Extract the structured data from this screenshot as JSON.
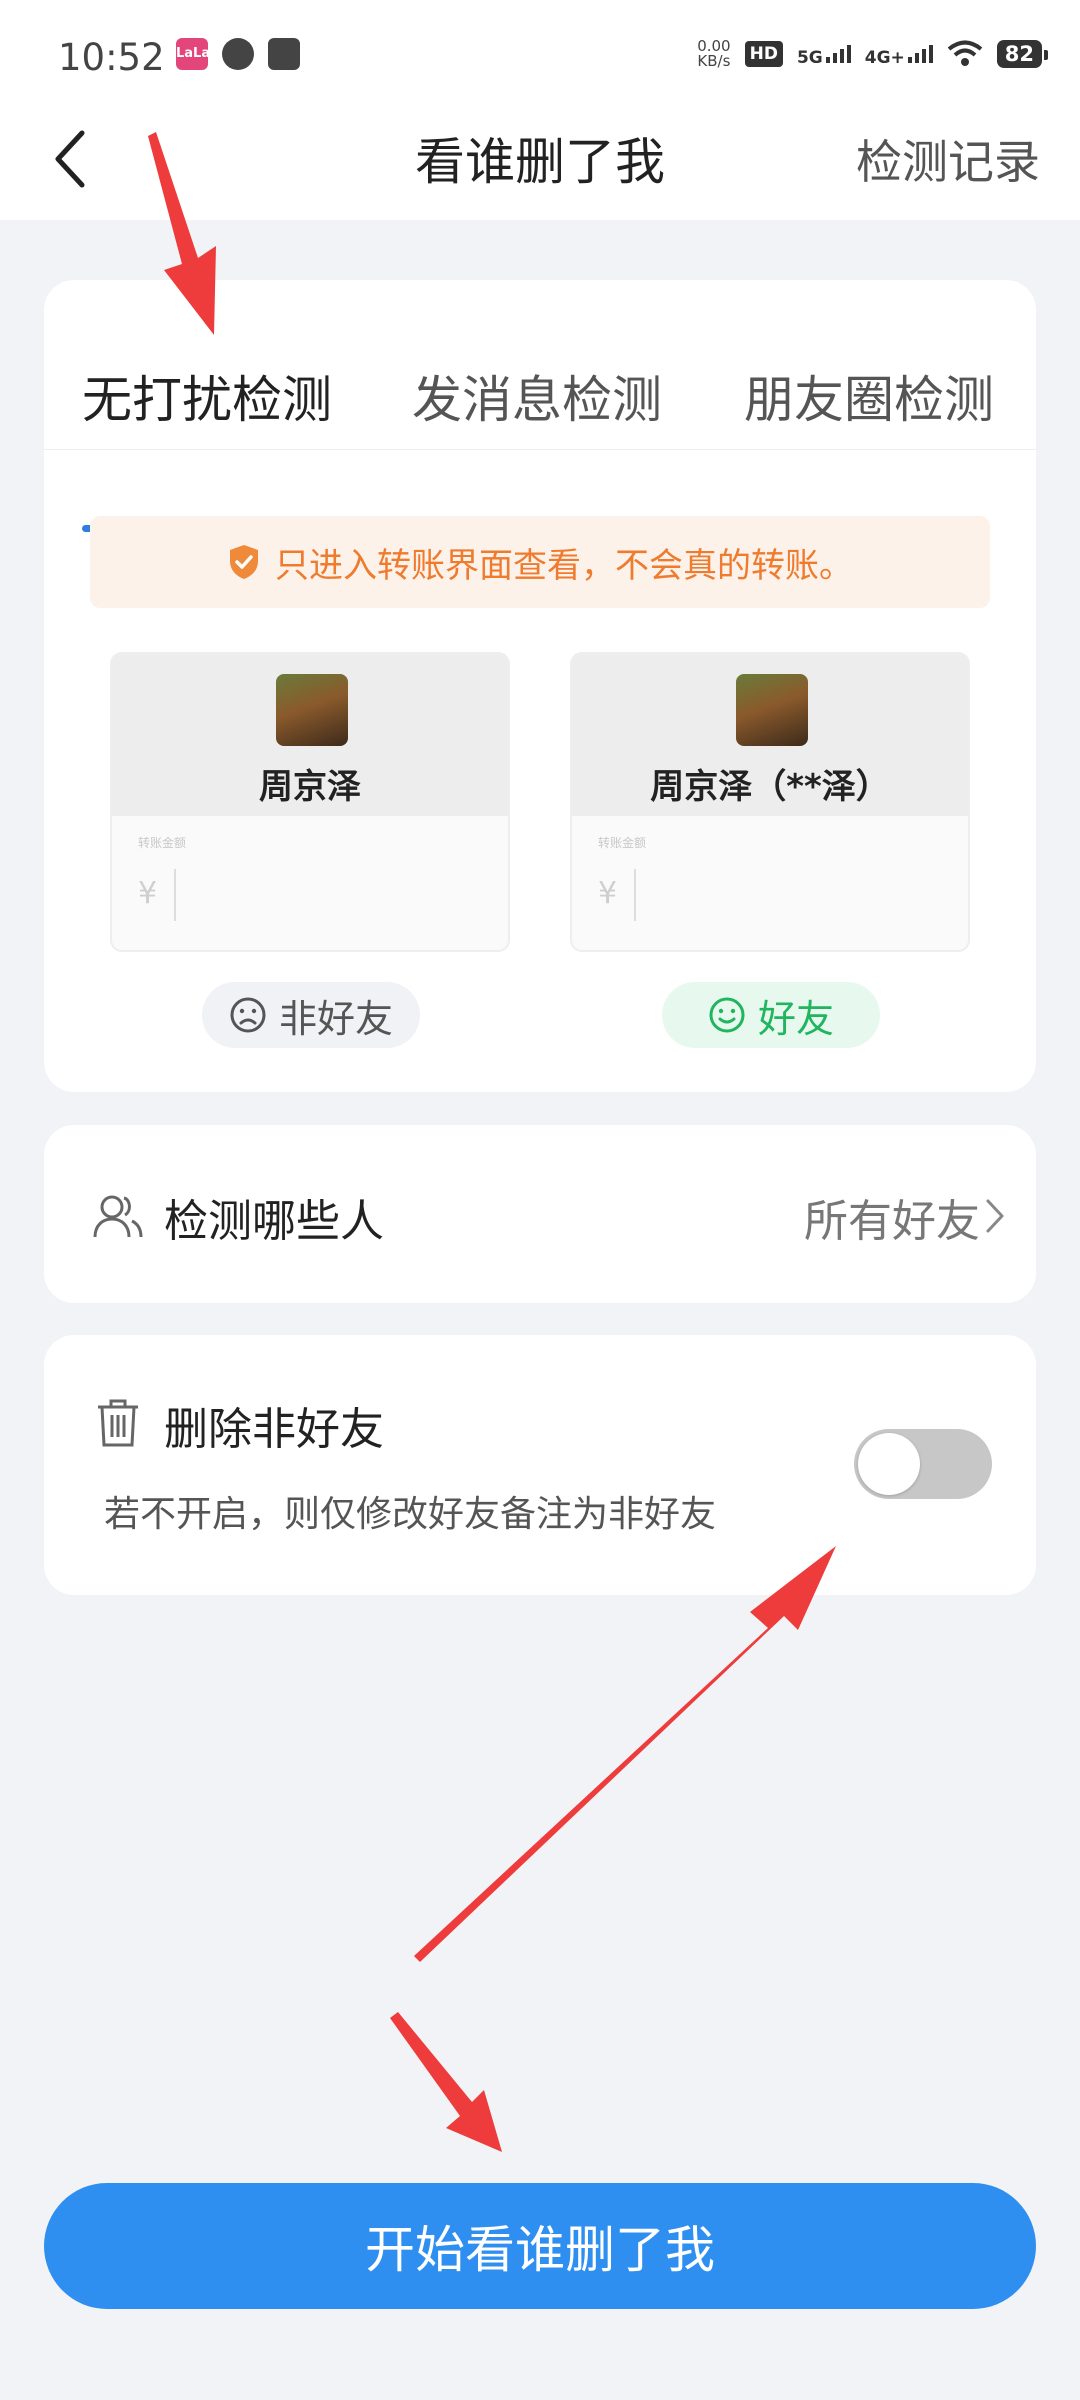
{
  "status_bar": {
    "time": "10:52",
    "net_speed_value": "0.00",
    "net_speed_unit": "KB/s",
    "hd_label": "HD",
    "sim1_label": "5G",
    "sim2_label": "4G+",
    "battery": "82",
    "app_icon_text": "LaLa"
  },
  "header": {
    "title": "看谁删了我",
    "right_action": "检测记录"
  },
  "tabs": [
    {
      "label": "无打扰检测",
      "active": true
    },
    {
      "label": "发消息检测",
      "active": false
    },
    {
      "label": "朋友圈检测",
      "active": false
    }
  ],
  "notice": {
    "text": "只进入转账界面查看，不会真的转账。",
    "color": "#ef7b2f"
  },
  "preview": {
    "left": {
      "name": "周京泽",
      "amount_label": "转账金额",
      "currency": "¥",
      "status": "非好友"
    },
    "right": {
      "name": "周京泽（**泽）",
      "amount_label": "转账金额",
      "currency": "¥",
      "status": "好友"
    }
  },
  "detect_targets": {
    "label": "检测哪些人",
    "value": "所有好友"
  },
  "delete_nonfriends": {
    "title": "删除非好友",
    "description": "若不开启，则仅修改好友备注为非好友",
    "enabled": false
  },
  "start_button": {
    "label": "开始看谁删了我",
    "color": "#2e8ff0"
  },
  "annotation_color": "#ee3b3b"
}
